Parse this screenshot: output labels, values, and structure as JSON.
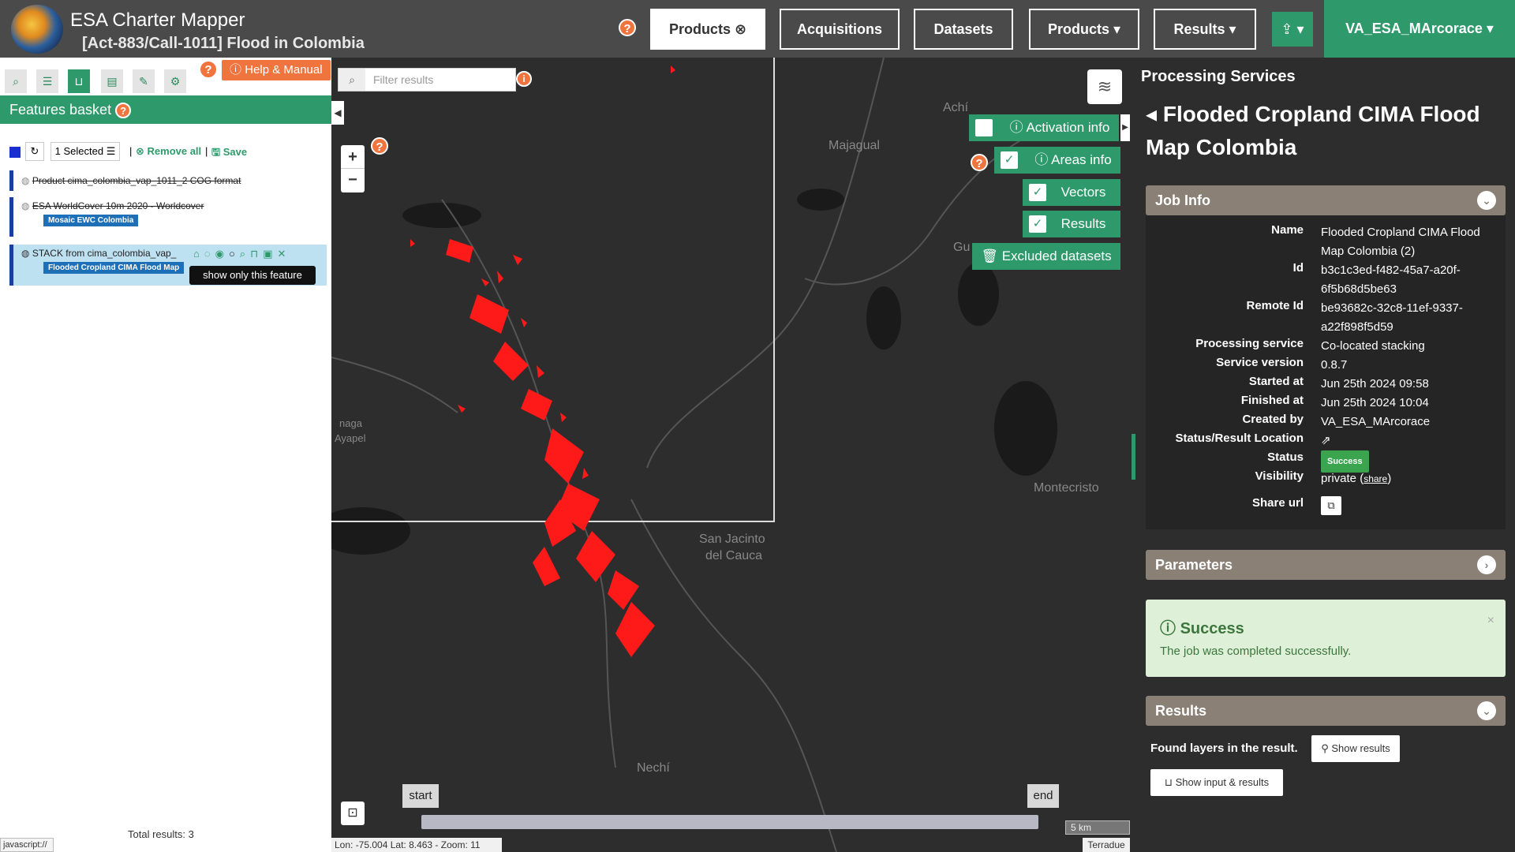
{
  "header": {
    "app_title": "ESA Charter Mapper",
    "subtitle": "[Act-883/Call-1011] Flood in Colombia",
    "nav": [
      "Products",
      "Acquisitions",
      "Datasets",
      "Products",
      "Results"
    ],
    "user": "VA_ESA_MArcorace"
  },
  "left": {
    "help_label": "Help & Manual",
    "basket_title": "Features basket",
    "selected_label": "1 Selected",
    "remove_all": "Remove all",
    "save": "Save",
    "items": [
      {
        "title": "Product cima_colombia_vap_1011_2 COG format",
        "tag": ""
      },
      {
        "title": "ESA WorldCover 10m 2020 - Worldcover",
        "tag": "Mosaic EWC Colombia"
      },
      {
        "title": "STACK from cima_colombia_vap_",
        "tag": "Flooded Cropland CIMA Flood Map"
      }
    ],
    "tooltip": "show only this feature",
    "total": "Total results: 3",
    "status": "javascript://"
  },
  "map": {
    "filter_placeholder": "Filter results",
    "toggles": [
      "Activation info",
      "Areas info",
      "Vectors",
      "Results",
      "Excluded datasets"
    ],
    "labels": [
      "Majagual",
      "Achí",
      "Gu",
      "Montecristo",
      "San Jacinto",
      "del Cauca",
      "Nechí",
      "naga",
      "Ayapel"
    ],
    "timeline_start": "start",
    "timeline_end": "end",
    "scale": "5 km",
    "coords": "Lon: -75.004 Lat: 8.463 - Zoom: 11",
    "attribution": "Terradue"
  },
  "right": {
    "section": "Processing Services",
    "title": "Flooded Cropland CIMA Flood Map Colombia",
    "job_info": "Job Info",
    "fields": [
      {
        "k": "Name",
        "v": "Flooded Cropland CIMA Flood Map Colombia (2)"
      },
      {
        "k": "Id",
        "v": "b3c1c3ed-f482-45a7-a20f-6f5b68d5be63"
      },
      {
        "k": "Remote Id",
        "v": "be93682c-32c8-11ef-9337-a22f898f5d59"
      },
      {
        "k": "Processing service",
        "v": "Co-located stacking"
      },
      {
        "k": "Service version",
        "v": "0.8.7"
      },
      {
        "k": "Started at",
        "v": "Jun 25th 2024 09:58"
      },
      {
        "k": "Finished at",
        "v": "Jun 25th 2024 10:04"
      },
      {
        "k": "Created by",
        "v": "VA_ESA_MArcorace"
      }
    ],
    "status_location": "Status/Result Location",
    "status_label": "Status",
    "status_value": "Success",
    "visibility_label": "Visibility",
    "visibility_value": "private",
    "share": "share",
    "share_url": "Share url",
    "parameters": "Parameters",
    "success_title": "Success",
    "success_text": "The job was completed successfully.",
    "results": "Results",
    "found_layers": "Found layers in the result.",
    "show_results": "Show results",
    "show_input_results": "Show input & results"
  },
  "colors": {
    "accent": "#2e9a6b",
    "header": "#4a4a4a",
    "flood": "#ff1a1a"
  }
}
